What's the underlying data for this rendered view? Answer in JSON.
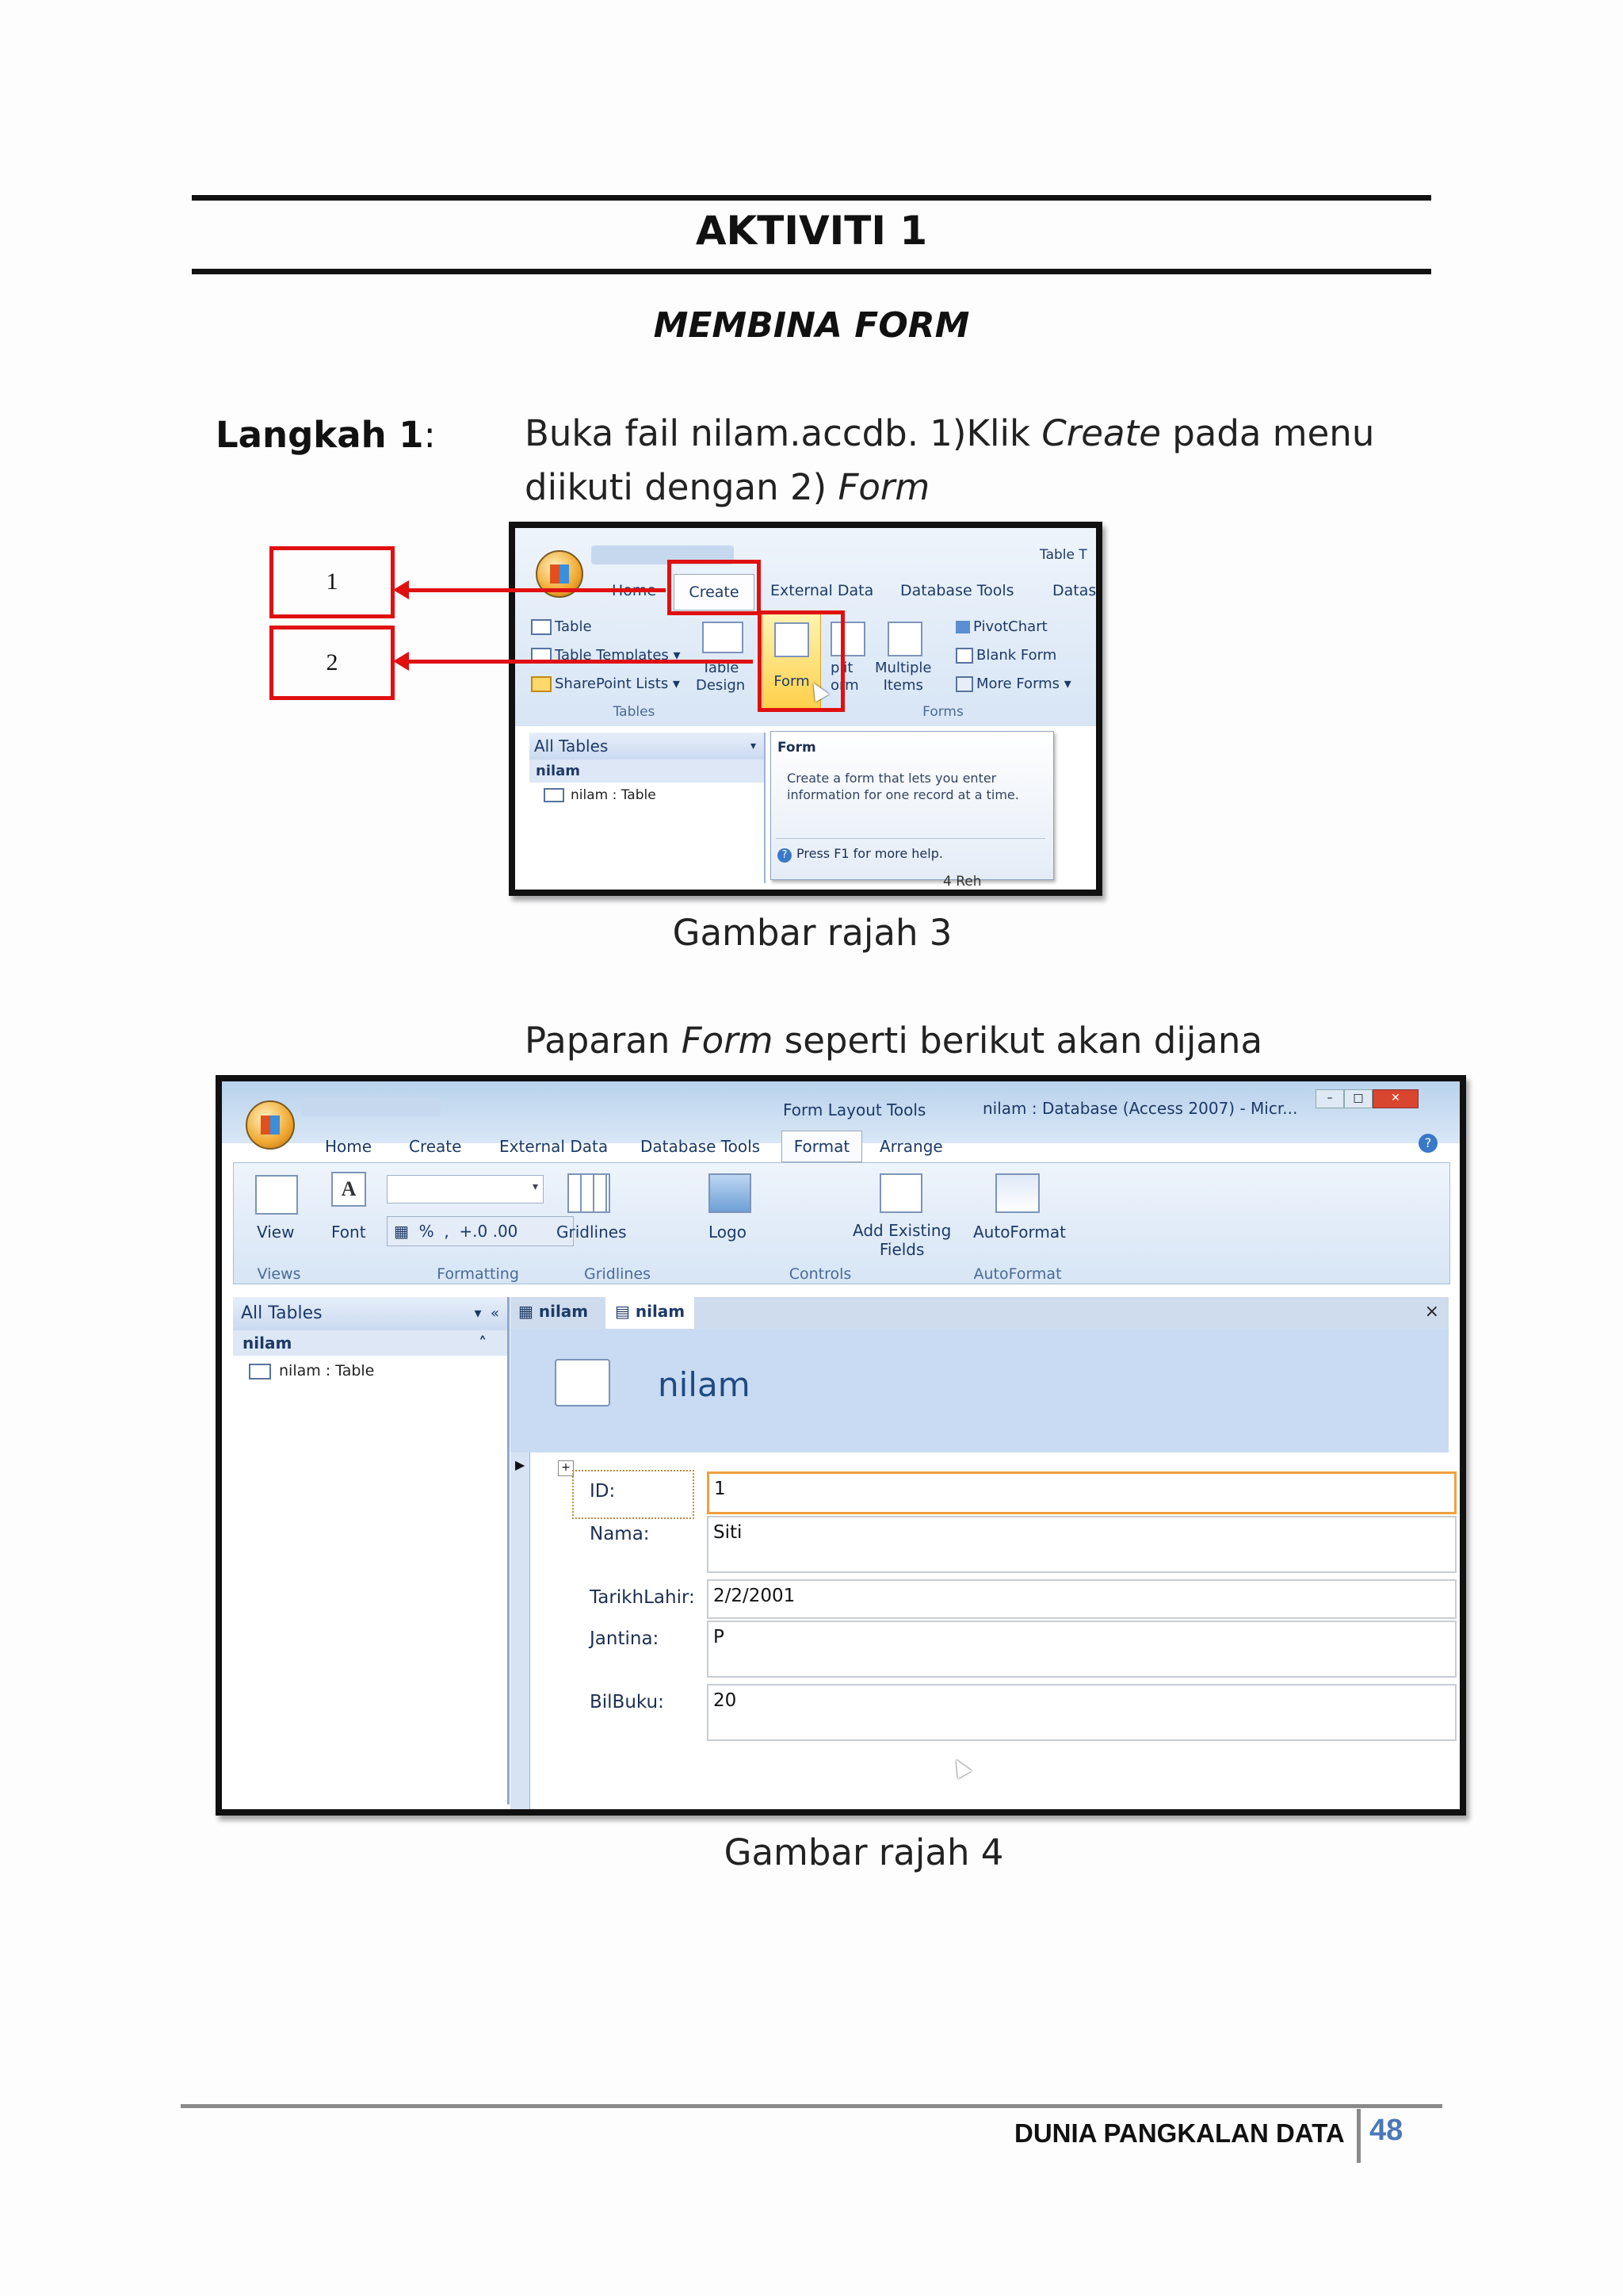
{
  "header": {
    "title": "AKTIVITI 1",
    "subtitle_plain": "MEMBINA ",
    "subtitle_italic": "FORM"
  },
  "step": {
    "label": "Langkah 1",
    "colon": ":",
    "line1_a": "Buka fail nilam.accdb. 1)Klik ",
    "line1_italic": "Create",
    "line1_b": " pada menu",
    "line2_a": "diikuti dengan 2) ",
    "line2_italic": "Form"
  },
  "callouts": {
    "one": "1",
    "two": "2"
  },
  "shot1": {
    "contextual": "Table T",
    "tabs": [
      "Home",
      "Create",
      "External Data",
      "Database Tools",
      "Datas"
    ],
    "tables_items": [
      "Table",
      "Table Templates",
      "SharePoint Lists"
    ],
    "table_design": [
      "Table",
      "Design"
    ],
    "form_btn": "Form",
    "split_form": [
      "plit",
      "orm"
    ],
    "multiple_items": [
      "Multiple",
      "Items"
    ],
    "forms_right": [
      "PivotChart",
      "Blank Form",
      "More Forms"
    ],
    "group_tables": "Tables",
    "group_forms": "Forms",
    "nav_header": "All Tables",
    "nav_group": "nilam",
    "nav_item": "nilam : Table",
    "tooltip_title": "Form",
    "tooltip_body": "Create a form that lets you enter information for one record at a time.",
    "tooltip_help": "Press F1 for more help.",
    "bottom_text": "4 Reh"
  },
  "caption3": "Gambar rajah 3",
  "para2_a": "Paparan ",
  "para2_italic": "Form",
  "para2_b": " seperti berikut akan dijana",
  "shot2": {
    "contextual": "Form Layout Tools",
    "window_title": "nilam : Database (Access 2007) - Micr...",
    "tabs": [
      "Home",
      "Create",
      "External Data",
      "Database Tools",
      "Format",
      "Arrange"
    ],
    "btn_view": "View",
    "btn_font": "Font",
    "btn_gridlines": "Gridlines",
    "btn_logo": "Logo",
    "btn_add_existing": [
      "Add Existing",
      "Fields"
    ],
    "btn_autoformat": "AutoFormat",
    "groups": [
      "Views",
      "Formatting",
      "Gridlines",
      "Controls",
      "AutoFormat"
    ],
    "nav_header": "All Tables",
    "nav_group": "nilam",
    "nav_item": "nilam : Table",
    "doc_tabs": [
      "nilam",
      "nilam"
    ],
    "form_title": "nilam",
    "fields": [
      {
        "label": "ID:",
        "value": "1"
      },
      {
        "label": "Nama:",
        "value": "Siti"
      },
      {
        "label": "TarikhLahir:",
        "value": "2/2/2001"
      },
      {
        "label": "Jantina:",
        "value": "P"
      },
      {
        "label": "BilBuku:",
        "value": "20"
      }
    ]
  },
  "caption4": "Gambar rajah 4",
  "footer": {
    "text": "DUNIA PANGKALAN DATA",
    "page": "48"
  }
}
